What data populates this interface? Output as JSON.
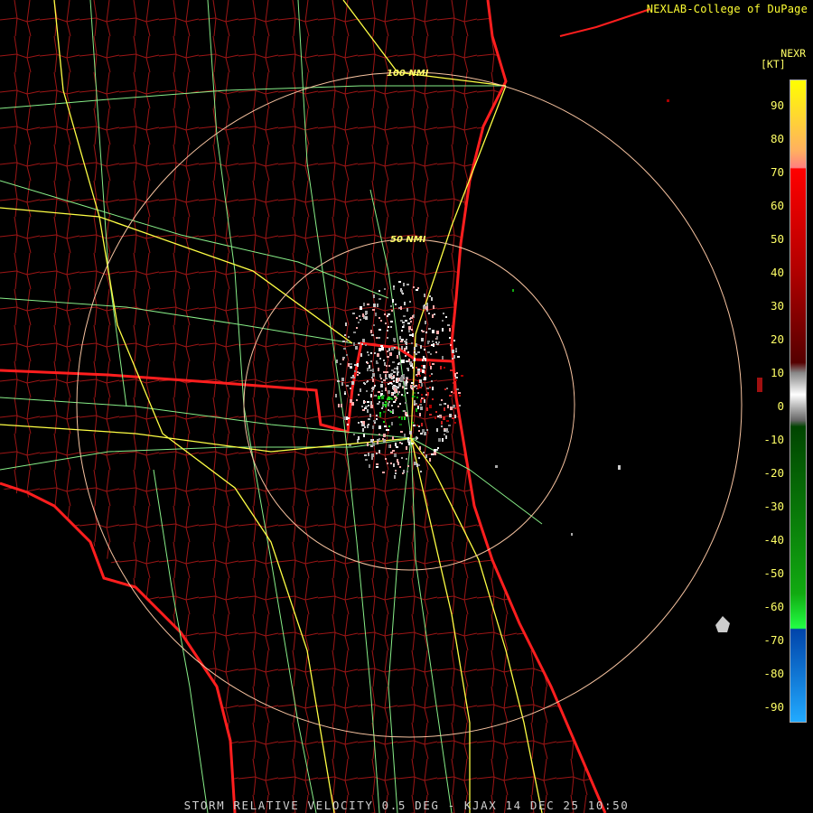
{
  "header": {
    "credit": "NEXLAB-College of DuPage"
  },
  "footer": {
    "product": "STORM RELATIVE VELOCITY 0.5 DEG - KJAX 14 DEC 25 10:50"
  },
  "legend": {
    "title": "NEXR",
    "unit": "[KT]",
    "ticks": [
      "90",
      "80",
      "70",
      "60",
      "50",
      "40",
      "30",
      "20",
      "10",
      "0",
      "-10",
      "-20",
      "-30",
      "-40",
      "-50",
      "-60",
      "-70",
      "-80",
      "-90"
    ]
  },
  "map": {
    "ring_labels": [
      "100 NMI",
      "50 NMI"
    ],
    "colors": {
      "county_lines": "#b81a1a",
      "state_coast": "#ff1e1e",
      "highways": "#88ee88",
      "interstates": "#ffff44",
      "range_rings": "#f7c3a0"
    }
  }
}
